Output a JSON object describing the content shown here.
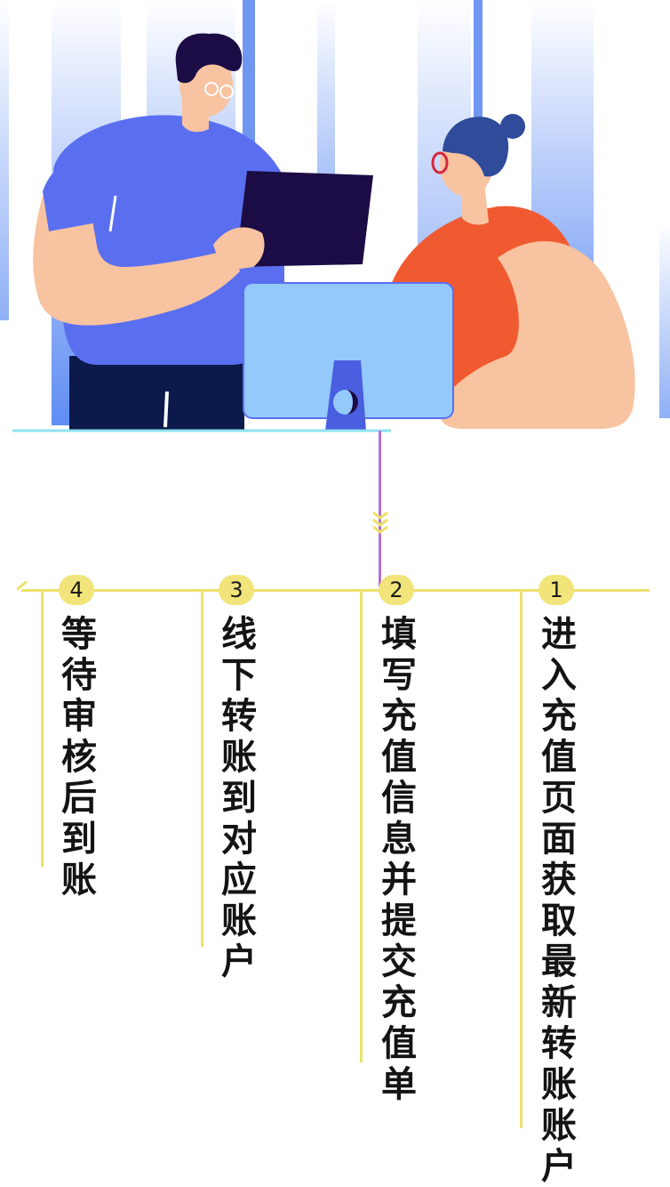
{
  "steps": [
    {
      "number": "1",
      "text": "进入充值页面获取最新转账账户"
    },
    {
      "number": "2",
      "text": "填写充值信息并提交充值单"
    },
    {
      "number": "3",
      "text": "线下转账到对应账户"
    },
    {
      "number": "4",
      "text": "等待审核后到账"
    }
  ],
  "colors": {
    "timeline_yellow": "#ece06c",
    "connector_purple": "#b56fd1",
    "man_shirt": "#5a6ff0",
    "woman_shirt": "#f05a30",
    "monitor": "#94c9fb",
    "skin": "#f8c3a0"
  },
  "illustration": {
    "icons": [
      "man-with-laptop",
      "woman-with-glasses",
      "monitor-icon"
    ]
  }
}
